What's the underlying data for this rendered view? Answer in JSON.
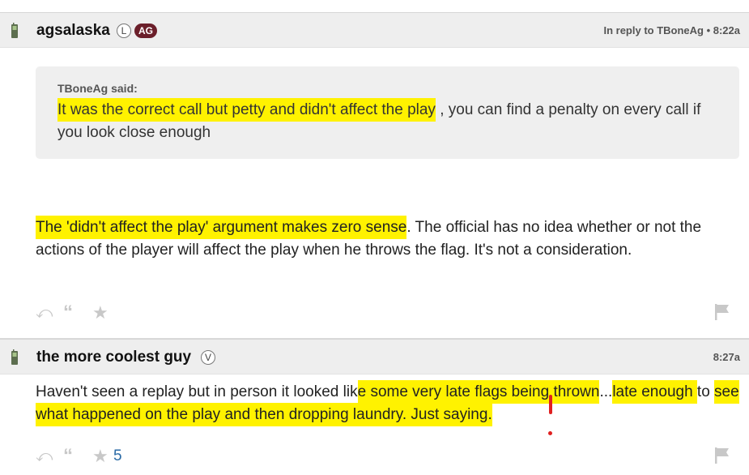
{
  "posts": [
    {
      "username": "agsalaska",
      "badges": {
        "level": "L",
        "group": "AG"
      },
      "meta": "In reply to TBoneAg • 8:22a",
      "quote": {
        "author": "TBoneAg said:",
        "text_highlighted": "It was the correct call but petty and didn't affect the play",
        "text_rest": " , you can find a penalty on every call if you look close enough"
      },
      "body_highlighted": "The 'didn't affect the play' argument makes zero sense",
      "body_rest": ". The official has no idea whether or not the actions of the player will affect the play when he throws the flag. It's not a consideration.",
      "icons": [
        "reply-icon",
        "quote-icon",
        "star-icon",
        "flag-icon"
      ]
    },
    {
      "username": "the more coolest guy",
      "badges": {
        "level": "V"
      },
      "meta": "8:27a",
      "body_parts": [
        "Haven't seen a replay but in person it looked lik",
        "e some very late flags being thrown",
        "...",
        "late enough ",
        "to ",
        "see what happened on the play and then dropping laundry. Just saying."
      ],
      "star_count": "5",
      "icons": [
        "reply-icon",
        "quote-icon",
        "star-icon",
        "flag-icon"
      ]
    }
  ],
  "colors": {
    "highlight": "#fff200",
    "badge_ag": "#6b1f2a",
    "star_count": "#2a6aa6",
    "annotation": "#e02020"
  }
}
